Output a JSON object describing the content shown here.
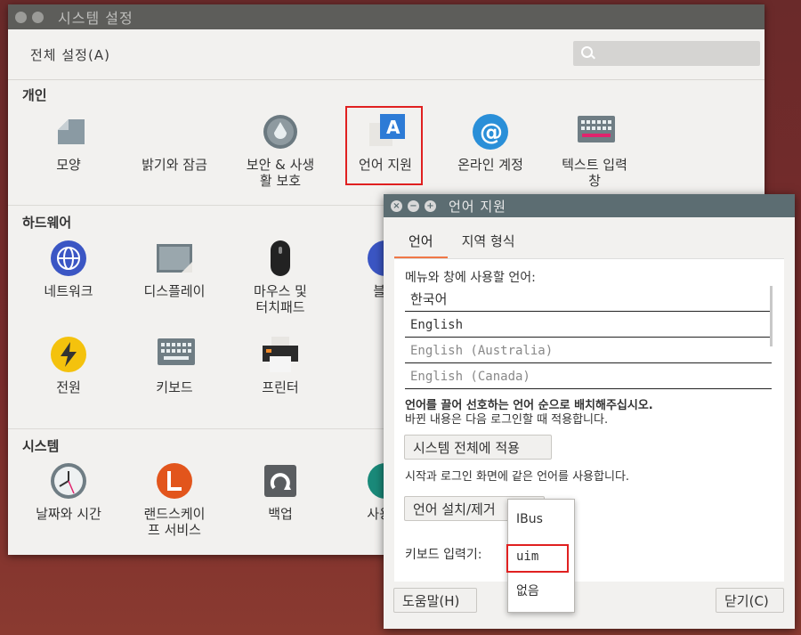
{
  "main_window": {
    "title": "시스템 설정",
    "all_settings": "전체 설정(A)",
    "sections": {
      "personal": "개인",
      "hardware": "하드웨어",
      "system": "시스템"
    },
    "personal_items": [
      "모양",
      "밝기와 잠금",
      "보안 & 사생\n활 보호",
      "언어 지원",
      "온라인 계정",
      "텍스트 입력\n창"
    ],
    "hardware_items": [
      "네트워크",
      "디스플레이",
      "마우스 및\n터치패드",
      "블루",
      "전원",
      "키보드",
      "프린터"
    ],
    "system_items": [
      "날짜와 시간",
      "랜드스케이\n프 서비스",
      "백업",
      "사용자"
    ]
  },
  "dialog": {
    "title": "언어 지원",
    "tabs": [
      "언어",
      "지역 형식"
    ],
    "menu_label": "메뉴와 창에 사용할 언어:",
    "languages": [
      "한국어",
      "English",
      "English (Australia)",
      "English (Canada)"
    ],
    "drag_hint": "언어를 끌어 선호하는 언어 순으로 배치해주십시오.",
    "apply_note": "바뀐 내용은 다음 로그인할 때 적용합니다.",
    "apply_button": "시스템 전체에 적용",
    "login_note": "시작과 로그인 화면에 같은 언어를 사용합니다.",
    "install_button": "언어 설치/제거",
    "keyboard_label": "키보드 입력기:",
    "help_button": "도움말(H)",
    "close_button": "닫기(C)"
  },
  "dropdown": {
    "options": [
      "IBus",
      "uim",
      "없음"
    ],
    "selected": "uim"
  },
  "colors": {
    "dialog_titlebar": "#5c6d72",
    "tab_accent": "#f07746",
    "highlight": "#e02020"
  }
}
